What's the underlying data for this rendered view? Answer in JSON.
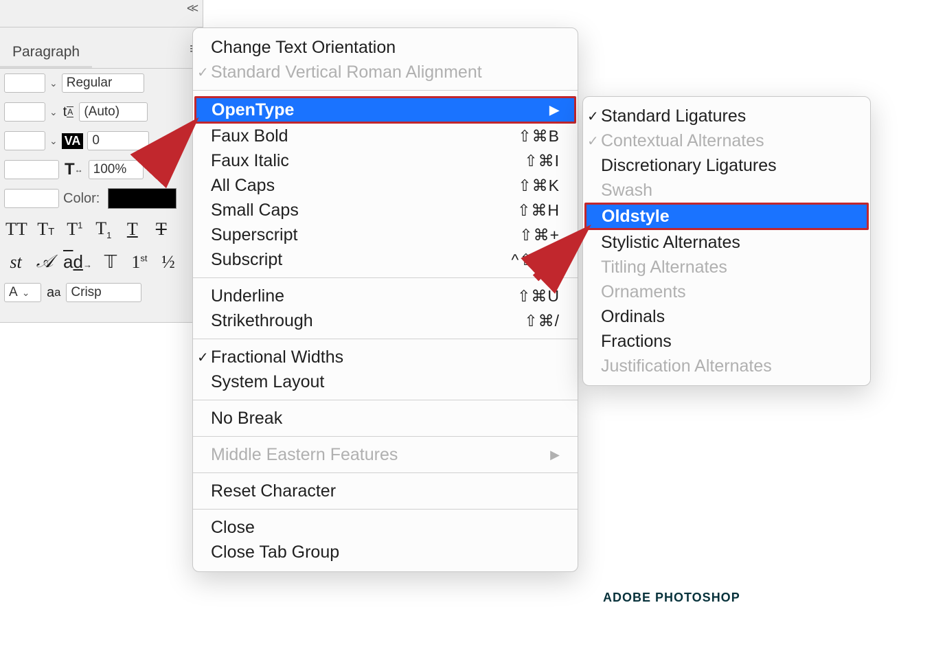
{
  "panel": {
    "tab": "Paragraph",
    "font_style": "Regular",
    "leading": "(Auto)",
    "tracking": "0",
    "hscale": "100%",
    "color_label": "Color:",
    "aa_label": "A",
    "aa_value": "Crisp"
  },
  "menu": {
    "change_orientation": "Change Text Orientation",
    "vroman": "Standard Vertical Roman Alignment",
    "opentype": "OpenType",
    "faux_bold": "Faux Bold",
    "faux_bold_k": "⇧⌘B",
    "faux_italic": "Faux Italic",
    "faux_italic_k": "⇧⌘I",
    "all_caps": "All Caps",
    "all_caps_k": "⇧⌘K",
    "small_caps": "Small Caps",
    "small_caps_k": "⇧⌘H",
    "superscript": "Superscript",
    "superscript_k": "⇧⌘+",
    "subscript": "Subscript",
    "subscript_k": "^⇧⌘+",
    "underline": "Underline",
    "underline_k": "⇧⌘U",
    "strike": "Strikethrough",
    "strike_k": "⇧⌘/",
    "frac_widths": "Fractional Widths",
    "sys_layout": "System Layout",
    "no_break": "No Break",
    "mideast": "Middle Eastern Features",
    "reset": "Reset Character",
    "close": "Close",
    "close_group": "Close Tab Group"
  },
  "submenu": {
    "std_lig": "Standard Ligatures",
    "ctx_alt": "Contextual Alternates",
    "disc_lig": "Discretionary Ligatures",
    "swash": "Swash",
    "oldstyle": "Oldstyle",
    "stylistic": "Stylistic Alternates",
    "titling": "Titling Alternates",
    "orn": "Ornaments",
    "ordinals": "Ordinals",
    "fractions": "Fractions",
    "just_alt": "Justification Alternates"
  },
  "caption": "ADOBE PHOTOSHOP"
}
